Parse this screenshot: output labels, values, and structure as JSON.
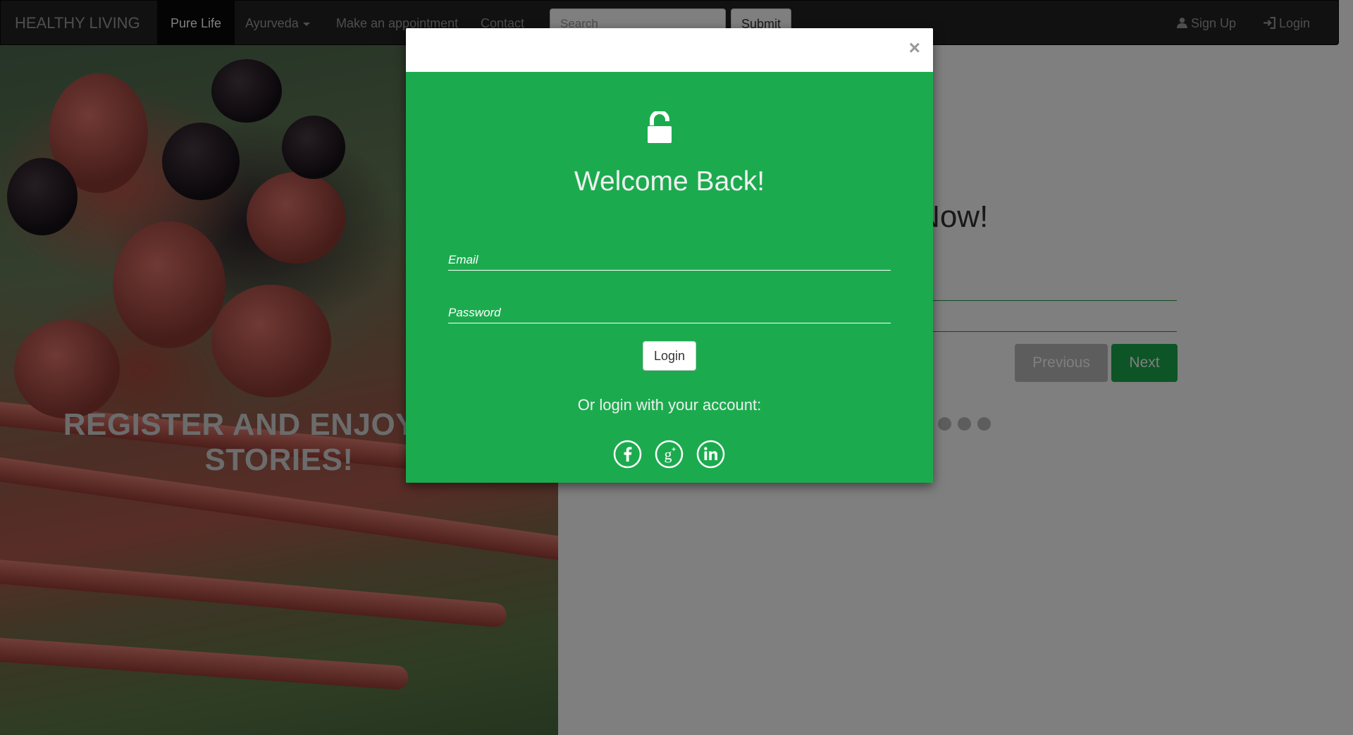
{
  "navbar": {
    "brand": "HEALTHY LIVING",
    "items": [
      {
        "label": "Pure Life",
        "active": true
      },
      {
        "label": "Ayurveda",
        "dropdown": true
      },
      {
        "label": "Make an appointment"
      },
      {
        "label": "Contact"
      }
    ],
    "search": {
      "placeholder": "Search"
    },
    "submit_label": "Submit",
    "right": [
      {
        "label": "Sign Up",
        "icon": "user-icon"
      },
      {
        "label": "Login",
        "icon": "log-in-icon"
      }
    ]
  },
  "hero": {
    "title": "REGISTER AND ENJOY OUR STORIES!"
  },
  "register": {
    "title": "Register Now!",
    "prev_label": "Previous",
    "next_label": "Next",
    "steps": {
      "total": 4,
      "current": 1
    }
  },
  "modal": {
    "close_label": "×",
    "icon": "unlock-icon",
    "title": "Welcome Back!",
    "email_placeholder": "Email",
    "password_placeholder": "Password",
    "login_label": "Login",
    "social_prompt": "Or login with your account:",
    "social": [
      "facebook-icon",
      "google-plus-icon",
      "linkedin-icon"
    ]
  },
  "colors": {
    "navbar": "#222222",
    "modal_green": "#1bab4e",
    "next_green": "#1aaa4d",
    "previous_grey": "#bbbbbb"
  }
}
